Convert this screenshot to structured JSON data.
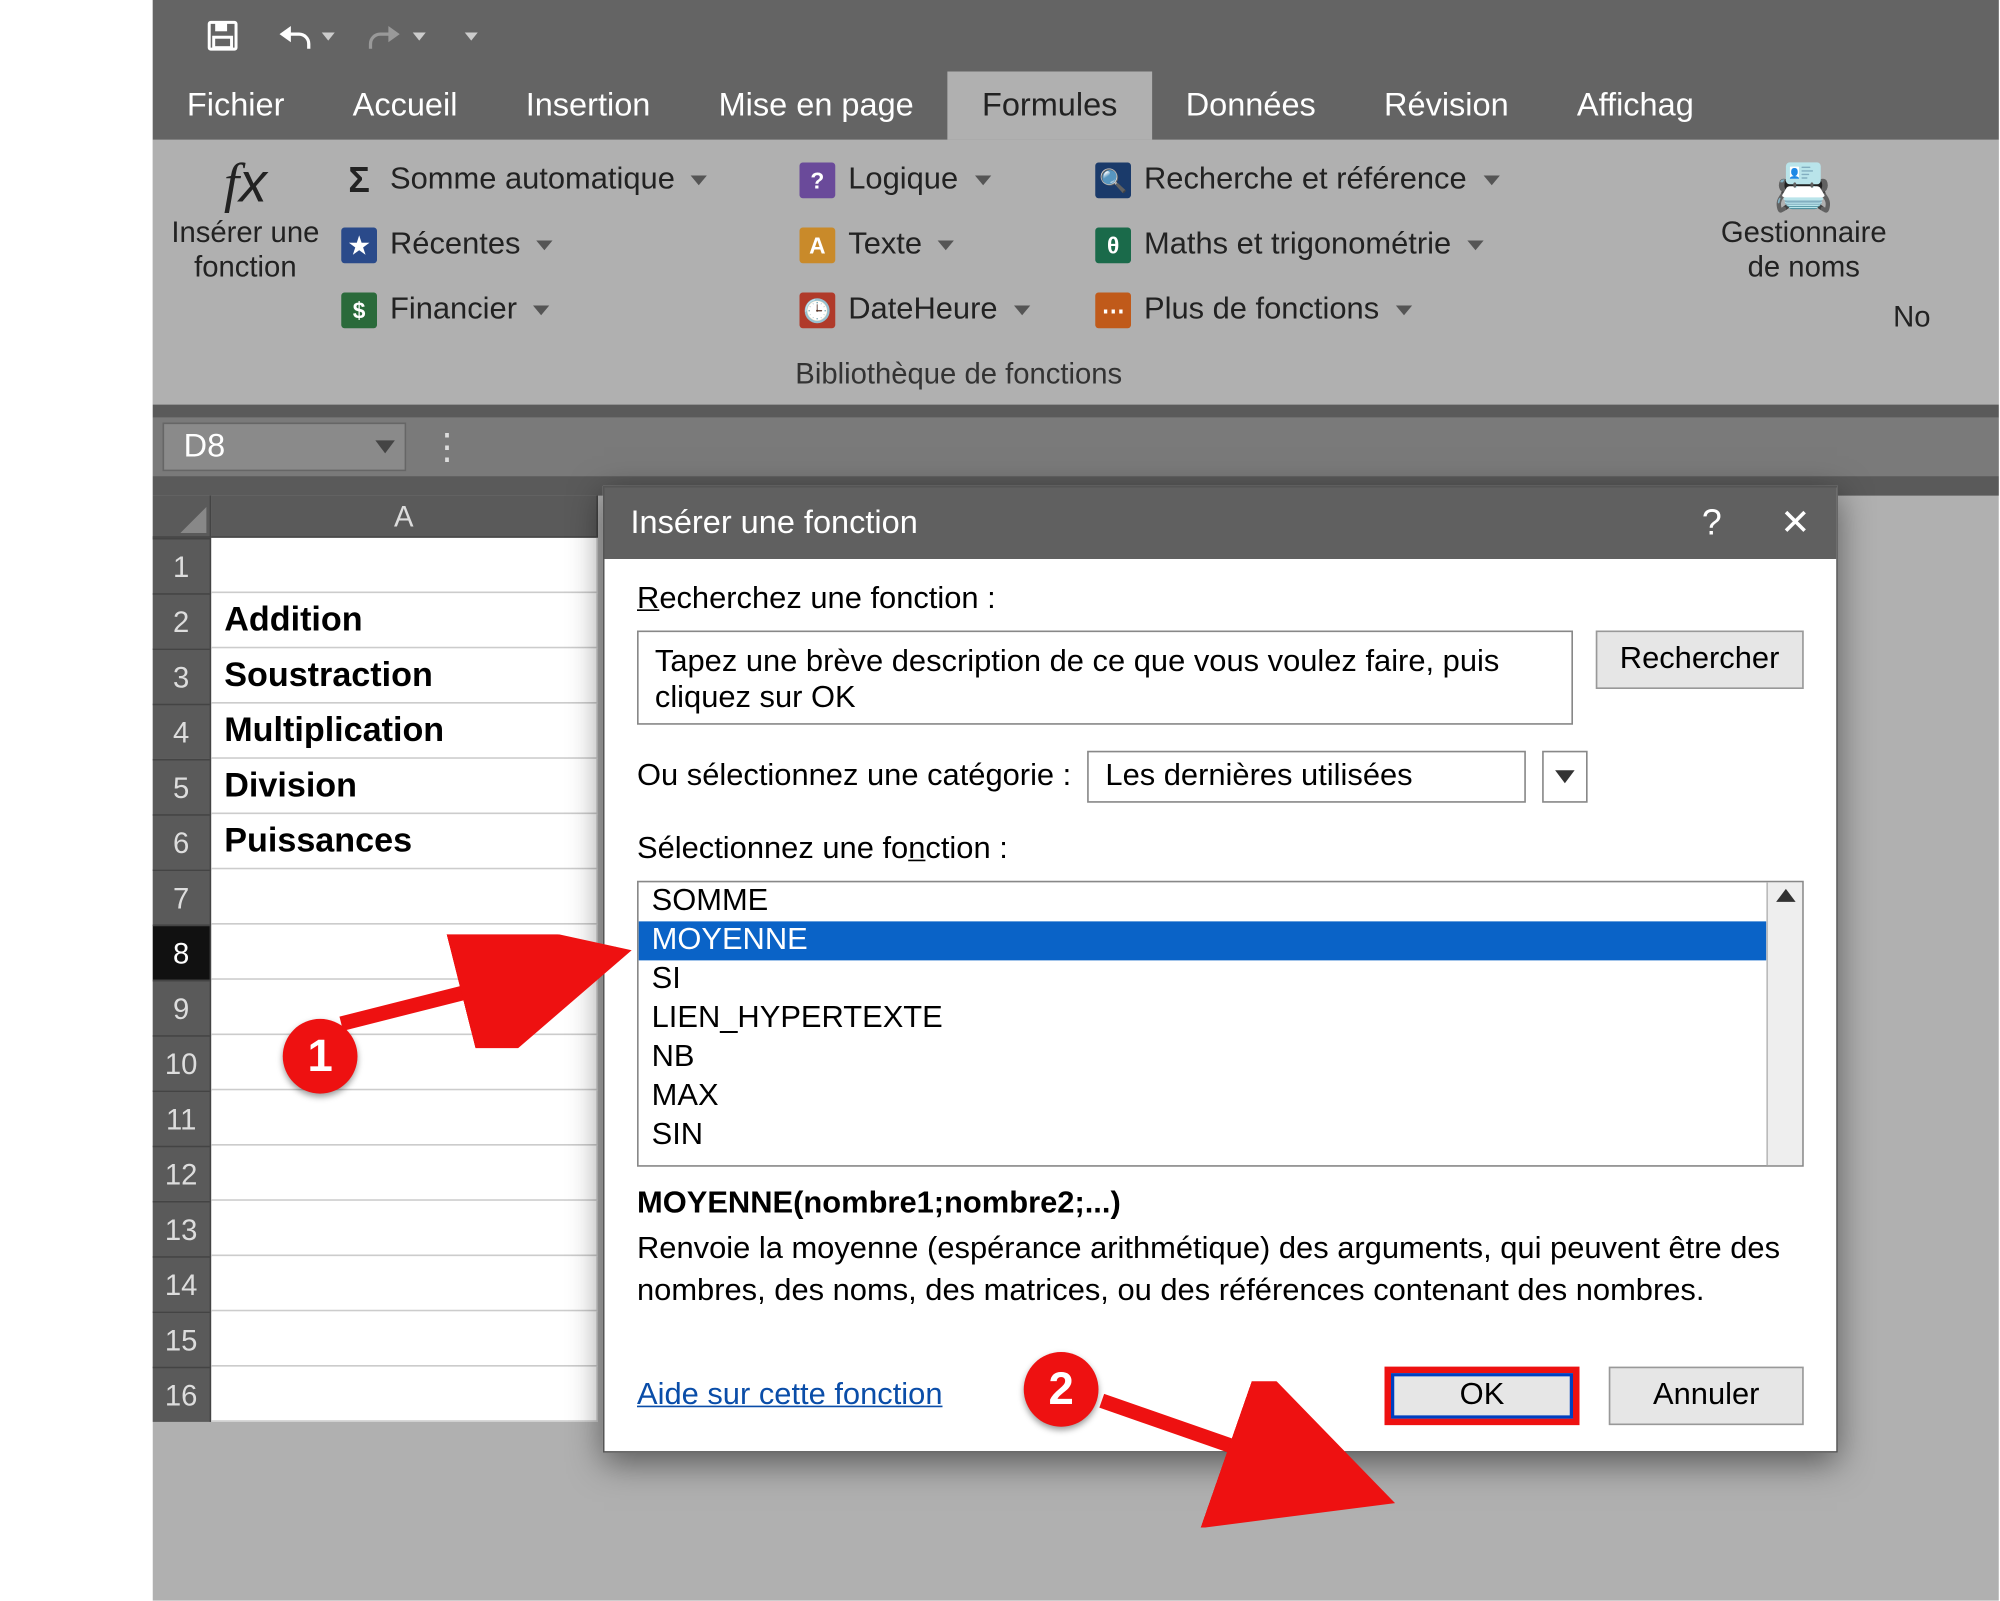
{
  "tabs": {
    "fichier": "Fichier",
    "accueil": "Accueil",
    "insertion": "Insertion",
    "mise": "Mise en page",
    "formules": "Formules",
    "donnees": "Données",
    "revision": "Révision",
    "affichage": "Affichag"
  },
  "ribbon": {
    "insert_fn_line1": "Insérer une",
    "insert_fn_line2": "fonction",
    "somme": "Somme automatique",
    "recentes": "Récentes",
    "financier": "Financier",
    "logique": "Logique",
    "texte": "Texte",
    "dateheure": "DateHeure",
    "recherche": "Recherche et référence",
    "maths": "Maths et trigonométrie",
    "plus": "Plus de fonctions",
    "lib_caption": "Bibliothèque de fonctions",
    "gest1": "Gestionnaire",
    "gest2": "de noms",
    "no": "No"
  },
  "fxrow": {
    "namebox": "D8"
  },
  "sheet": {
    "colA": "A",
    "rows": [
      "",
      "Addition",
      "Soustraction",
      "Multiplication",
      "Division",
      "Puissances",
      "",
      "",
      "",
      "",
      "",
      "",
      "",
      "",
      "",
      ""
    ]
  },
  "dialog": {
    "title": "Insérer une fonction",
    "search_label_pre": "R",
    "search_label_rest": "echerchez une fonction :",
    "search_value": "Tapez une brève description de ce que vous voulez faire, puis cliquez sur OK",
    "search_btn_pre": "R",
    "search_btn_rest": "echercher",
    "cat_label_pre": "Ou sélectionnez une ",
    "cat_label_u": "c",
    "cat_label_post": "atégorie :",
    "cat_value": "Les dernières utilisées",
    "list_label_pre": "Sélectionnez une fo",
    "list_label_u": "n",
    "list_label_post": "ction :",
    "functions": [
      "SOMME",
      "MOYENNE",
      "SI",
      "LIEN_HYPERTEXTE",
      "NB",
      "MAX",
      "SIN"
    ],
    "selected_index": 1,
    "signature": "MOYENNE(nombre1;nombre2;...)",
    "description": "Renvoie la moyenne (espérance arithmétique) des arguments, qui peuvent être des nombres, des noms, des matrices, ou des références contenant des nombres.",
    "help": "Aide sur cette fonction",
    "ok": "OK",
    "cancel": "Annuler"
  },
  "callouts": {
    "one": "1",
    "two": "2"
  }
}
